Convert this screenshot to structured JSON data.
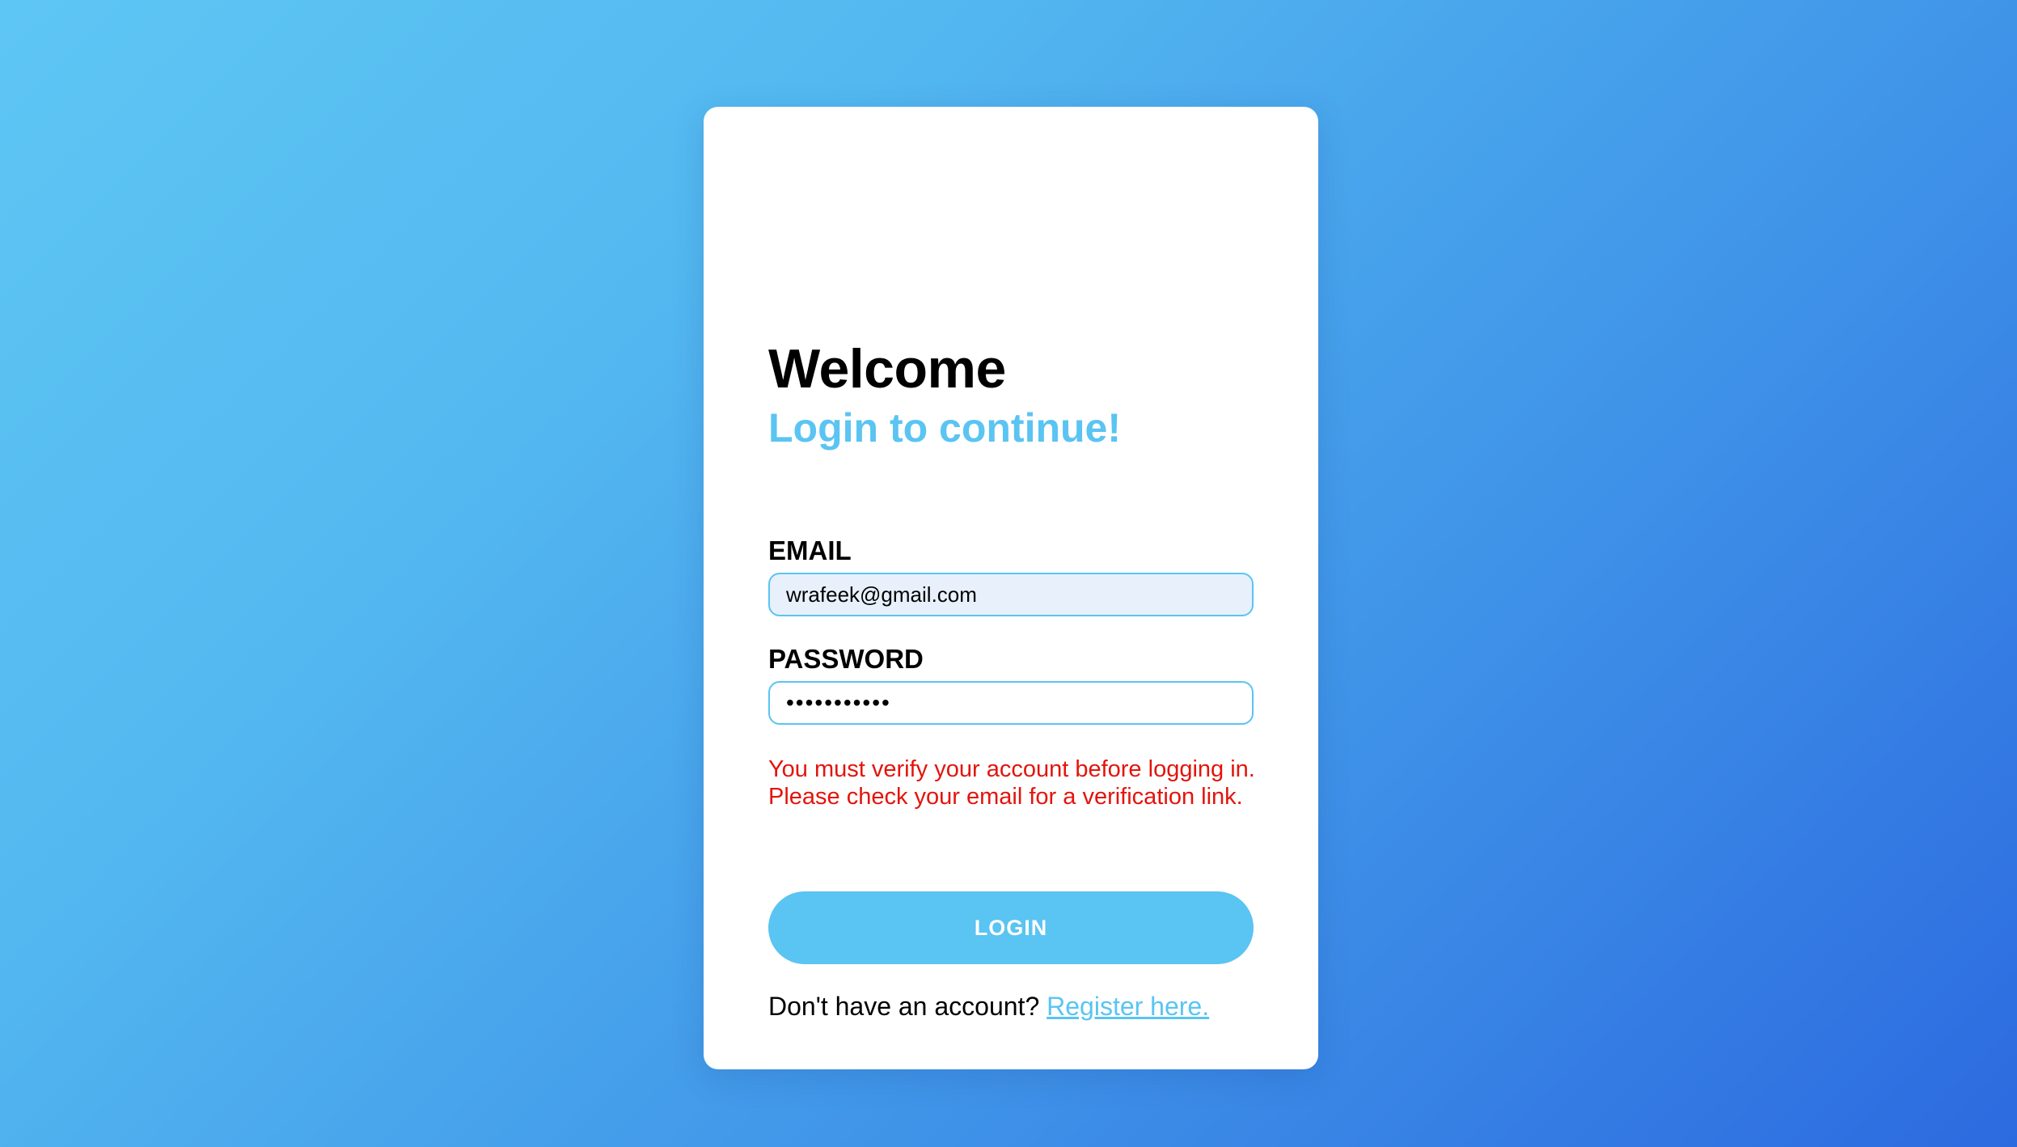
{
  "card": {
    "title": "Welcome",
    "subtitle": "Login to continue!"
  },
  "form": {
    "email_label": "EMAIL",
    "email_value": "wrafeek@gmail.com",
    "password_label": "PASSWORD",
    "password_value": "•••••••••••",
    "error_line1": "You must verify your account before logging in.",
    "error_line2": "Please check your email for a verification link.",
    "login_label": "LOGIN"
  },
  "footer": {
    "prompt": "Don't have an account? ",
    "register_label": "Register here."
  },
  "colors": {
    "accent": "#5ac4f2",
    "error": "#e3140c",
    "autofill_bg": "#e8f0fc",
    "gradient_start": "#5ec6f4",
    "gradient_end": "#2c6ae0"
  }
}
